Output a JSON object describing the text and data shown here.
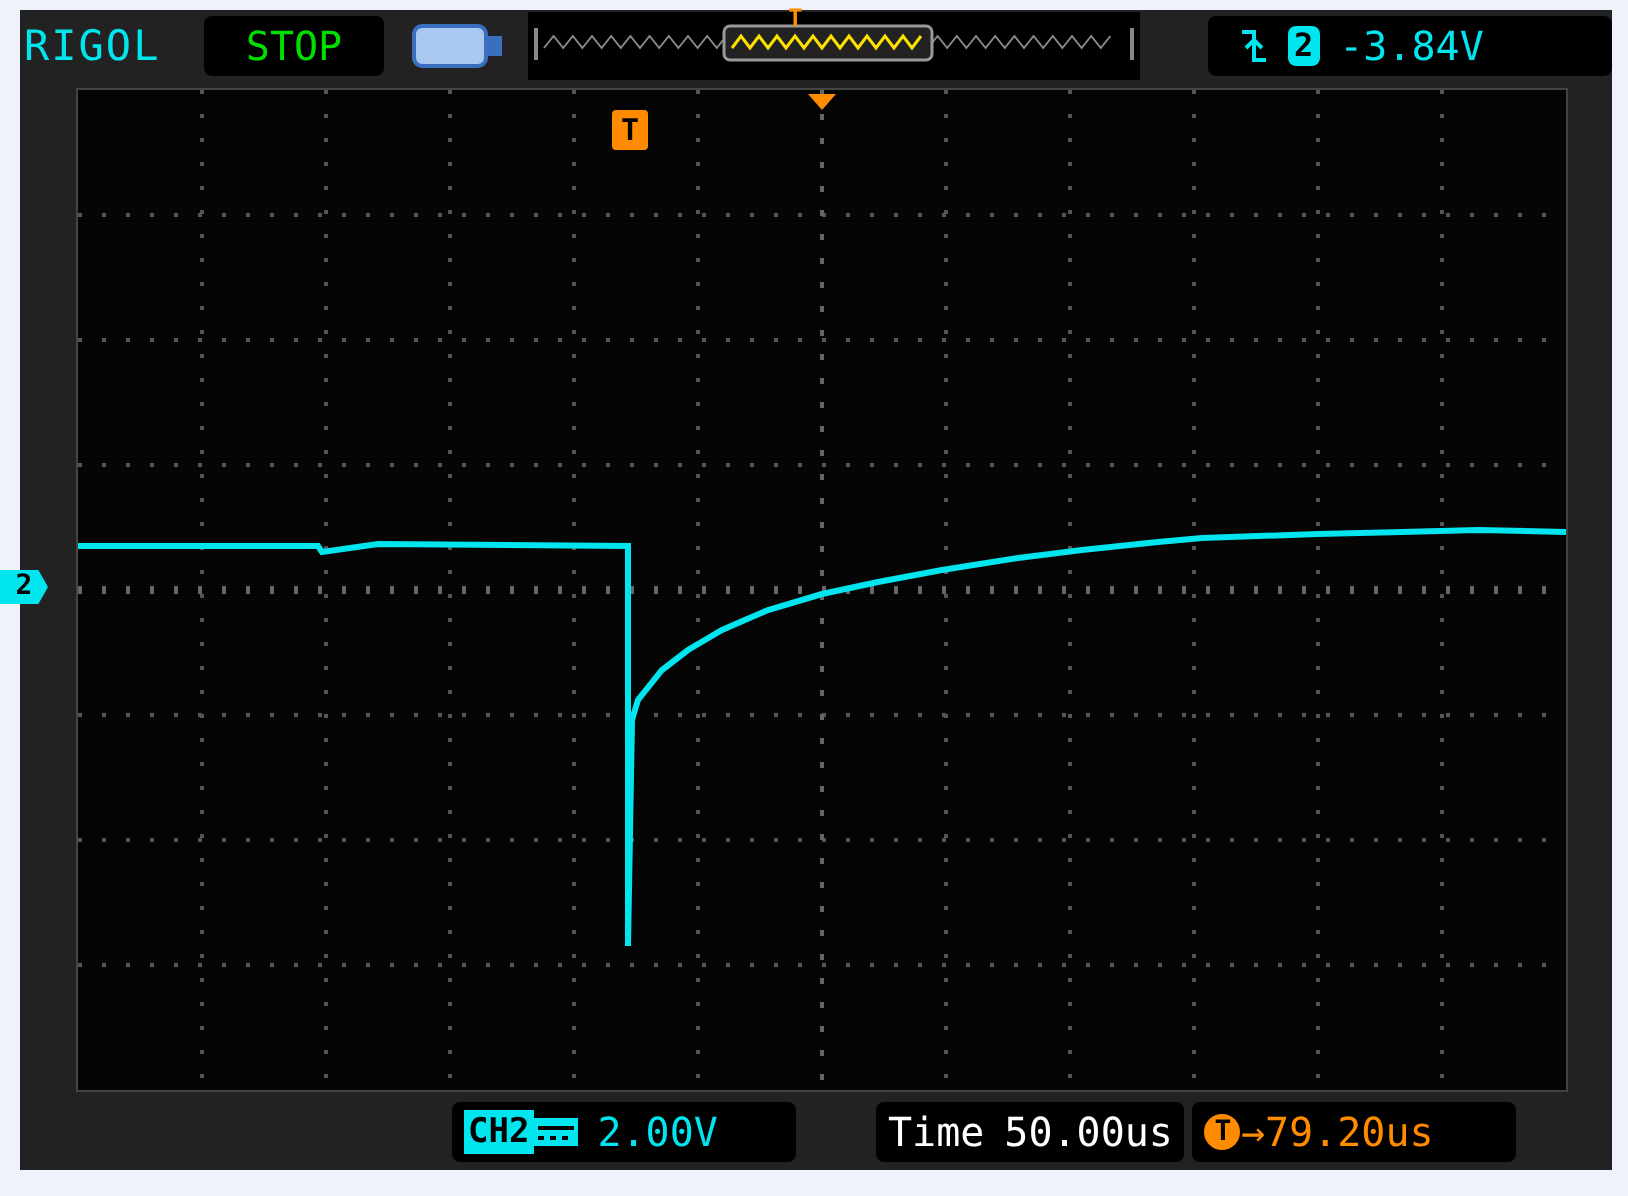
{
  "brand": "RIGOL",
  "run_status": "STOP",
  "memory_bar": {
    "trigger_marker": "T"
  },
  "trigger": {
    "channel": "2",
    "level": "-3.84V"
  },
  "screen": {
    "channel_marker": "2",
    "trigger_marker": "T"
  },
  "channel_scale": {
    "label": "CH2",
    "value": "2.00V"
  },
  "timebase": {
    "label": "Time",
    "value": "50.00us"
  },
  "trigger_offset": {
    "marker": "T",
    "arrow": "→",
    "value": "79.20us"
  }
}
